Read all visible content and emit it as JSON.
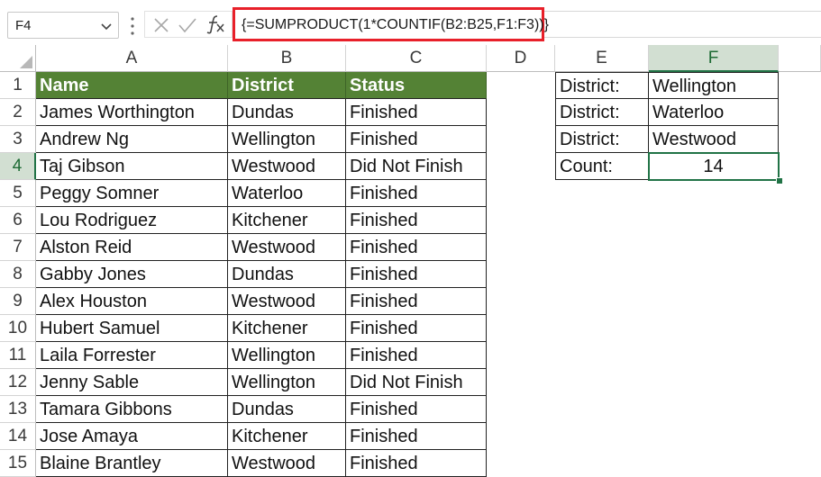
{
  "formula_bar": {
    "name_box": "F4",
    "formula": "{=SUMPRODUCT(1*COUNTIF(B2:B25,F1:F3))}",
    "icons": [
      "chevron-down-icon",
      "more-options-icon",
      "cancel-icon",
      "enter-icon",
      "function-icon"
    ]
  },
  "columns": [
    "A",
    "B",
    "C",
    "D",
    "E",
    "F"
  ],
  "rows": [
    "1",
    "2",
    "3",
    "4",
    "5",
    "6",
    "7",
    "8",
    "9",
    "10",
    "11",
    "12",
    "13",
    "14",
    "15"
  ],
  "selected_cell": "F4",
  "table": {
    "headers": [
      "Name",
      "District",
      "Status"
    ],
    "rows": [
      [
        "James Worthington",
        "Dundas",
        "Finished"
      ],
      [
        "Andrew Ng",
        "Wellington",
        "Finished"
      ],
      [
        "Taj Gibson",
        "Westwood",
        "Did Not Finish"
      ],
      [
        "Peggy Somner",
        "Waterloo",
        "Finished"
      ],
      [
        "Lou Rodriguez",
        "Kitchener",
        "Finished"
      ],
      [
        "Alston Reid",
        "Westwood",
        "Finished"
      ],
      [
        "Gabby Jones",
        "Dundas",
        "Finished"
      ],
      [
        "Alex Houston",
        "Westwood",
        "Finished"
      ],
      [
        "Hubert Samuel",
        "Kitchener",
        "Finished"
      ],
      [
        "Laila Forrester",
        "Wellington",
        "Finished"
      ],
      [
        "Jenny Sable",
        "Wellington",
        "Did Not Finish"
      ],
      [
        "Tamara Gibbons",
        "Dundas",
        "Finished"
      ],
      [
        "Jose Amaya",
        "Kitchener",
        "Finished"
      ],
      [
        "Blaine Brantley",
        "Westwood",
        "Finished"
      ]
    ]
  },
  "criteria": {
    "rows": [
      [
        "District:",
        "Wellington"
      ],
      [
        "District:",
        "Waterloo"
      ],
      [
        "District:",
        "Westwood"
      ]
    ],
    "count_label": "Count:",
    "count_value": "14"
  },
  "colors": {
    "header_fill": "#548235",
    "selection": "#217346",
    "formula_highlight": "#e8202a"
  }
}
